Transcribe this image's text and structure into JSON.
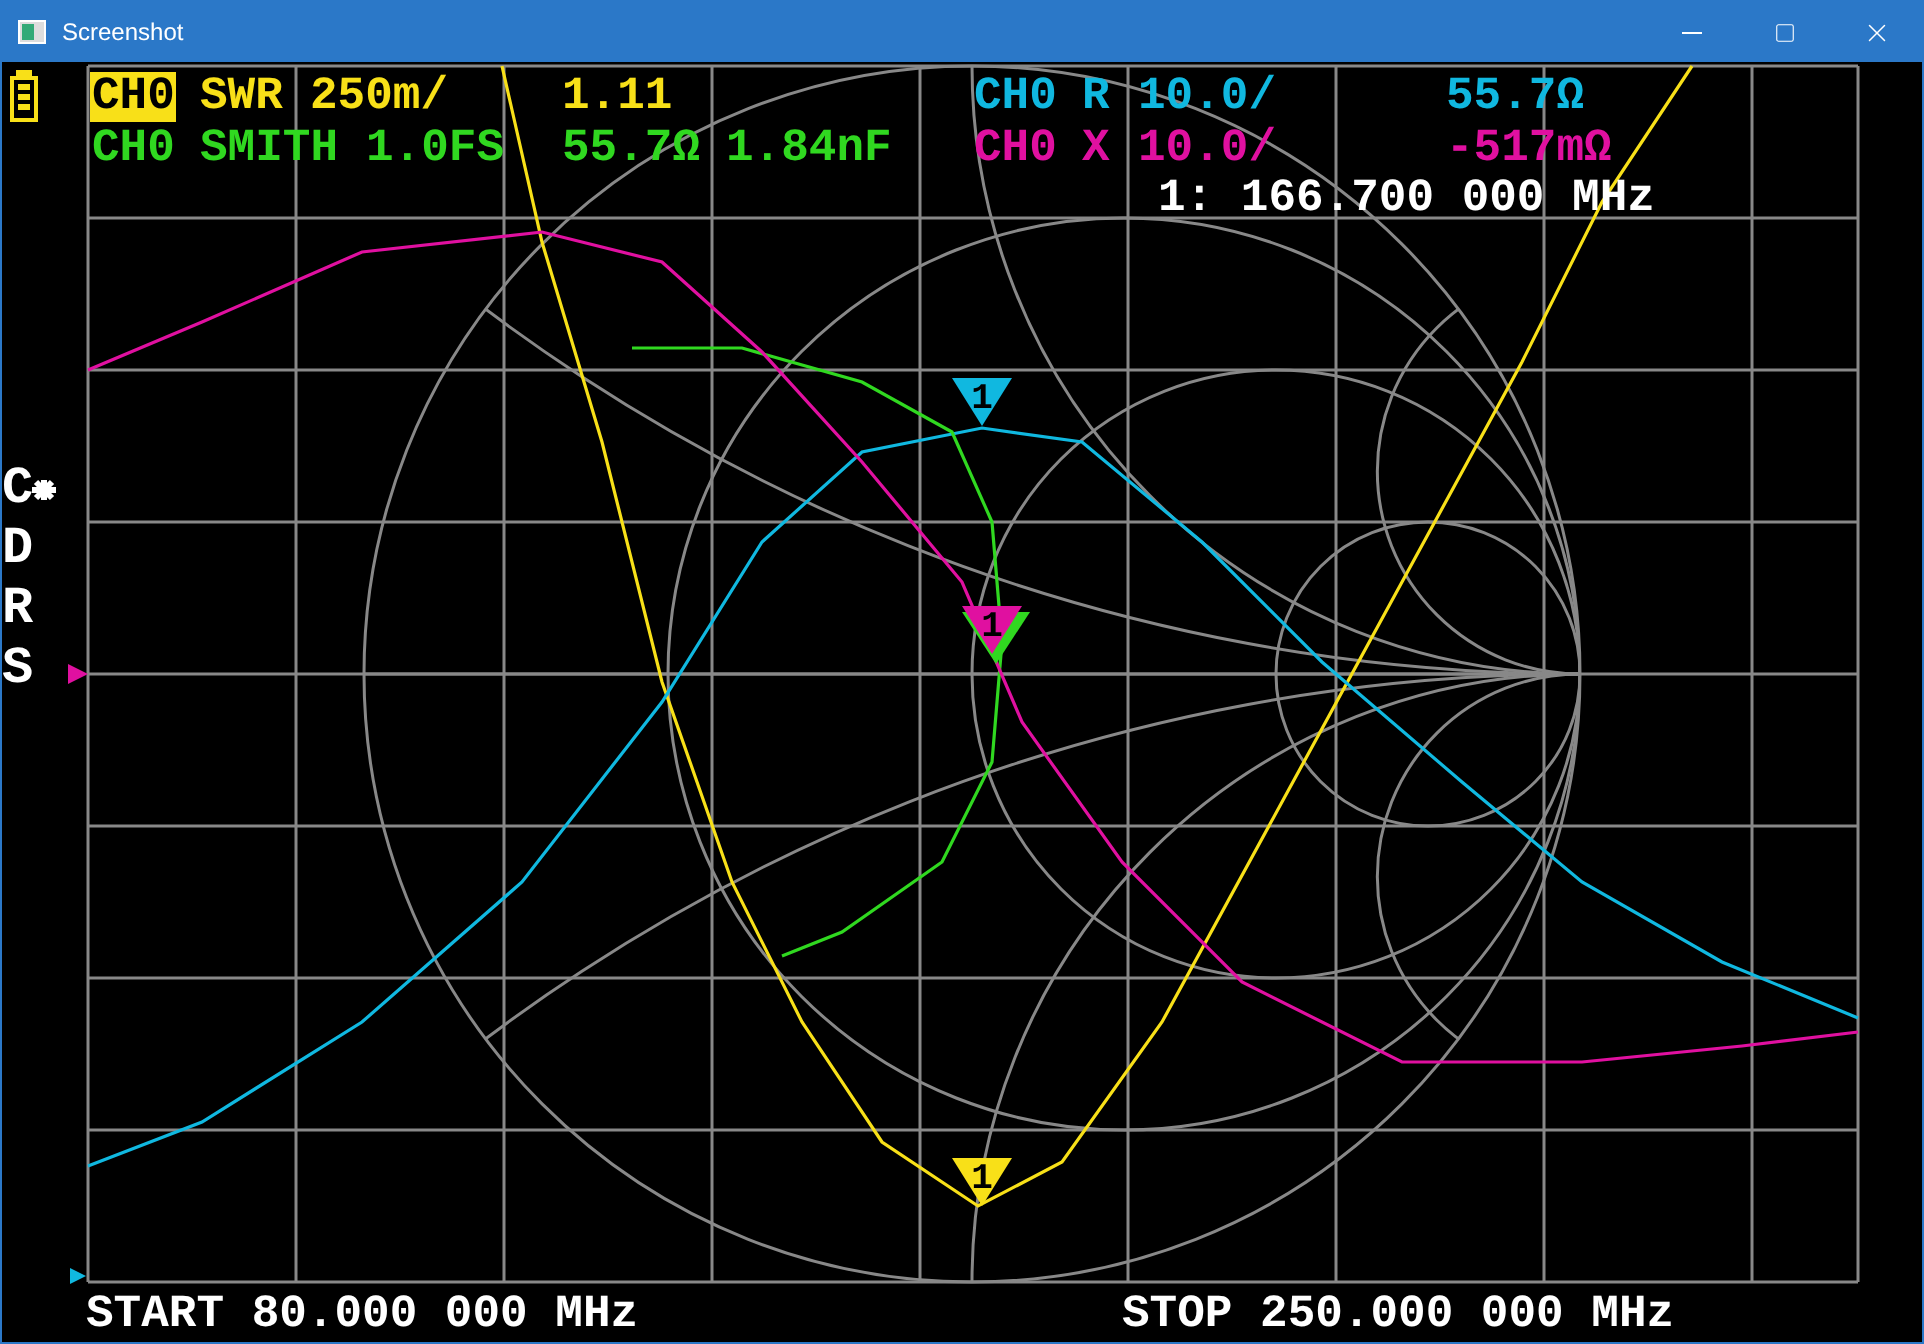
{
  "window": {
    "title": "Screenshot"
  },
  "traces": [
    {
      "channel": "CH0",
      "selected": true,
      "format": "SWR",
      "scale": "250m/",
      "values": [
        "1.11"
      ],
      "color": "#f8e018"
    },
    {
      "channel": "CH0",
      "selected": false,
      "format": "R",
      "scale": "10.0/",
      "values": [
        "55.7Ω"
      ],
      "color": "#10b8e0"
    },
    {
      "channel": "CH0",
      "selected": false,
      "format": "SMITH",
      "scale": "1.0FS",
      "values": [
        "55.7Ω",
        "1.84nF"
      ],
      "color": "#30d820"
    },
    {
      "channel": "CH0",
      "selected": false,
      "format": "X",
      "scale": "10.0/",
      "values": [
        "-517mΩ"
      ],
      "color": "#e010a0"
    }
  ],
  "markers": [
    {
      "label": "1",
      "color": "#10b8e0"
    },
    {
      "color": "#30d820"
    },
    {
      "label": "1",
      "color": "#e010a0"
    },
    {
      "label": "1",
      "color": "#f8e018"
    }
  ],
  "marker_frequency": "1: 166.700 000 MHz",
  "side_menu": [
    "C",
    "D",
    "R",
    "S"
  ],
  "start": "START 80.000 000 MHz",
  "stop": "STOP 250.000 000 MHz"
}
